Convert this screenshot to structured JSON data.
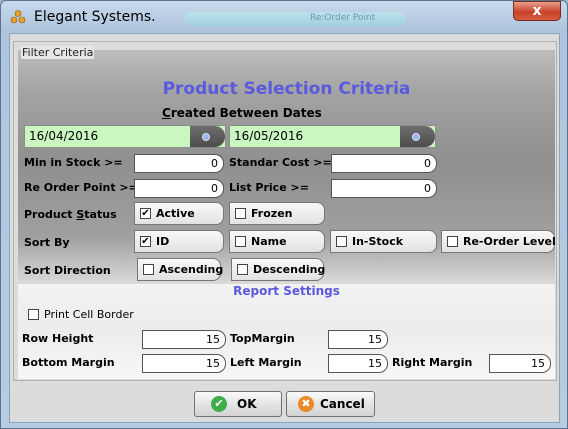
{
  "window": {
    "title": "Elegant Systems.",
    "blurred_title": "Re:Order Point",
    "close_glyph": "x"
  },
  "icons": {
    "app": "app-icon",
    "ok": "checkmark-icon",
    "cancel": "cancel-icon",
    "date_picker": "date-picker-icon"
  },
  "colors": {
    "heading": "#5a5adf",
    "date_bg": "#c9f7bf",
    "ok_icon": "#3fae4a",
    "cancel_icon": "#e88a27"
  },
  "filter": {
    "legend": "Filter Criteria",
    "heading": "Product Selection Criteria",
    "created_between_label": "Created Between Dates",
    "date_from": "16/04/2016",
    "date_to": "16/05/2016",
    "min_stock_label": "Min in Stock >=",
    "min_stock_value": "0",
    "standard_cost_label": "Standar Cost >=",
    "standard_cost_value": "0",
    "reorder_label": "Re Order Point >=",
    "reorder_value": "0",
    "list_price_label": "List Price >=",
    "list_price_value": "0",
    "status_label_pre": "Product ",
    "status_label_u": "S",
    "status_label_post": "tatus",
    "status_active": "Active",
    "status_active_check": "✔",
    "status_frozen": "Frozen",
    "sort_by_label": "Sort By",
    "sort_id": "ID",
    "sort_id_check": "✔",
    "sort_name": "Name",
    "sort_instock": "In-Stock",
    "sort_reorder": "Re-Order Level",
    "sort_dir_label": "Sort Direction",
    "sort_asc": "Ascending",
    "sort_desc": "Descending"
  },
  "report": {
    "heading": "Report Settings",
    "print_border": "Print Cell Border",
    "row_height_label": "Row Height",
    "row_height_value": "15",
    "top_margin_label": "TopMargin",
    "top_margin_value": "15",
    "bottom_margin_label": "Bottom Margin",
    "bottom_margin_value": "15",
    "left_margin_label": "Left Margin",
    "left_margin_value": "15",
    "right_margin_label": "Right Margin",
    "right_margin_value": "15"
  },
  "buttons": {
    "ok": "OK",
    "ok_glyph": "✔",
    "cancel": "Cancel",
    "cancel_glyph": "✖"
  }
}
